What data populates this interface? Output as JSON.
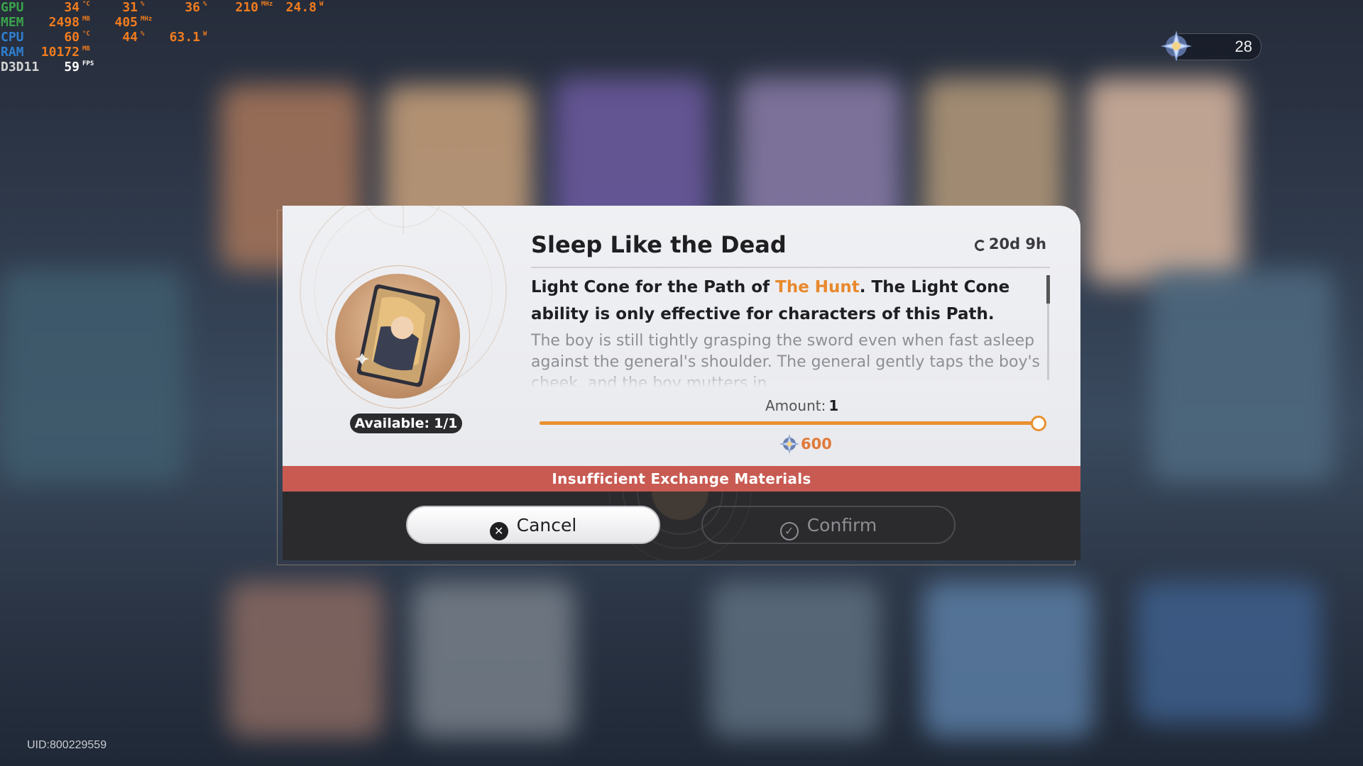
{
  "perf": {
    "gpu": {
      "label": "GPU",
      "temp": "34",
      "temp_unit": "°C",
      "load": "31",
      "load_unit": "%",
      "load2": "36",
      "load2_unit": "%",
      "clock": "210",
      "clock_unit": "MHz",
      "power": "24.8",
      "power_unit": "W"
    },
    "mem": {
      "label": "MEM",
      "used": "2498",
      "used_unit": "MB",
      "clock": "405",
      "clock_unit": "MHz"
    },
    "cpu": {
      "label": "CPU",
      "temp": "60",
      "temp_unit": "°C",
      "load": "44",
      "load_unit": "%",
      "power": "63.1",
      "power_unit": "W"
    },
    "ram": {
      "label": "RAM",
      "used": "10172",
      "used_unit": "MB"
    },
    "api": {
      "label": "D3D11",
      "fps": "59",
      "fps_unit": "FPS"
    }
  },
  "currency": {
    "amount": "28",
    "icon": "star-rail-special-pass-icon"
  },
  "uid": "UID:800229559",
  "dialog": {
    "title": "Sleep Like the Dead",
    "timer": "20d 9h",
    "desc_prefix": "Light Cone for the Path of ",
    "desc_path": "The Hunt",
    "desc_suffix": ". The Light Cone ability is only effective for characters of this Path.",
    "flavor": "The boy is still tightly grasping the sword even when fast asleep against the general's shoulder. The general gently taps the boy's cheek, and the boy mutters in",
    "available_label": "Available:",
    "available_value": "1/1",
    "amount_label": "Amount:",
    "amount_value": "1",
    "slider_fraction": 1.0,
    "cost": "600",
    "warning": "Insufficient Exchange Materials",
    "cancel_label": "Cancel",
    "confirm_label": "Confirm",
    "colors": {
      "accent": "#e8912f",
      "path_highlight": "#e8892d",
      "warning_bg": "#c85a52",
      "cost": "#e07a3a"
    }
  }
}
